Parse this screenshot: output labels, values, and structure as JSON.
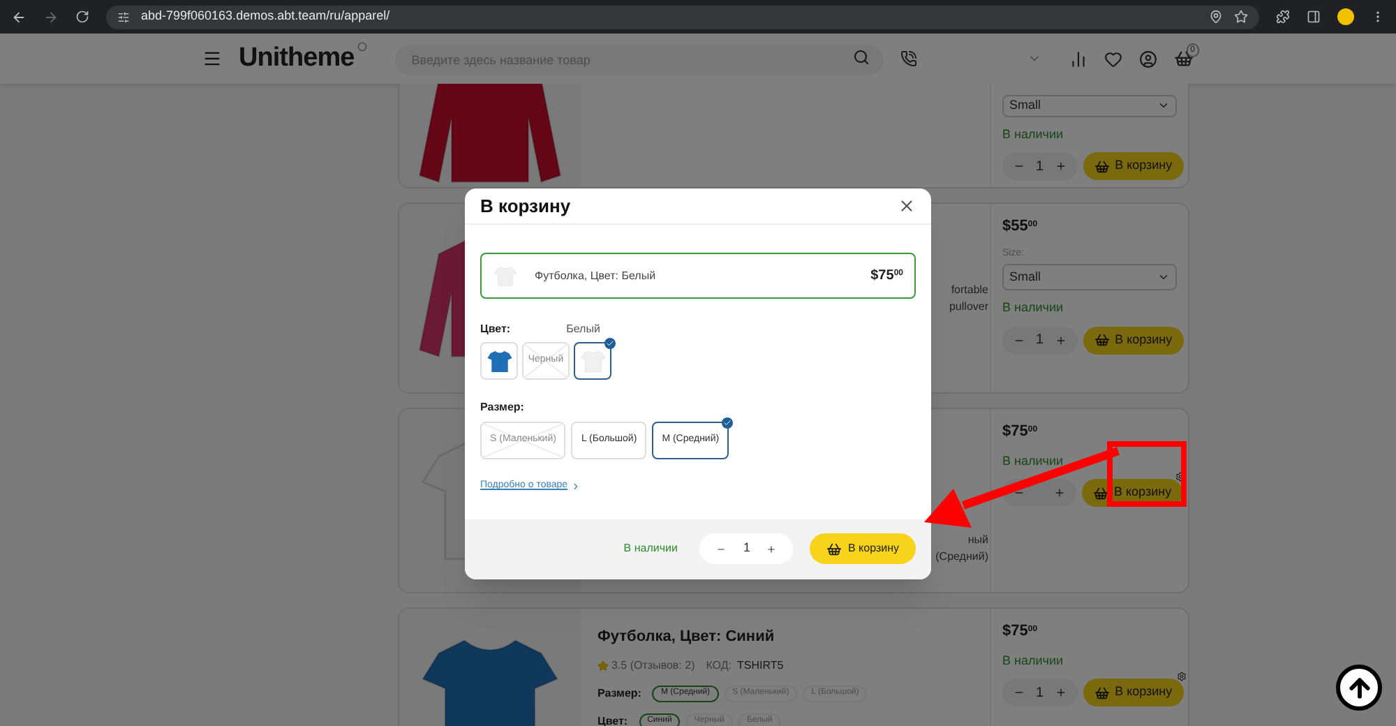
{
  "browser": {
    "url": "abd-799f060163.demos.abt.team/ru/apparel/"
  },
  "header": {
    "logo": "Unitheme",
    "search_placeholder": "Введите здесь название товар",
    "cart_count": "0"
  },
  "products": [
    {
      "kind": "partial",
      "garment": {
        "kind": "sweater",
        "color": "#640817"
      },
      "select": "Small",
      "stock": "В наличии",
      "qty": "1",
      "button": "В корзину",
      "settings_badge": false
    },
    {
      "kind": "covered",
      "garment": {
        "kind": "sweater",
        "color": "#6b1a36"
      },
      "fragments": [
        "fortable",
        "pullover"
      ],
      "price": "$55$^{00}$",
      "select_label": "Size:",
      "select": "Small",
      "stock": "В наличии",
      "qty": "1",
      "button": "В корзину",
      "settings_badge": false
    },
    {
      "kind": "covered",
      "garment": {
        "kind": "tshirt",
        "color": "#787878"
      },
      "fragments": [
        "ный",
        "(Средний)"
      ],
      "price": "$75$^{00}$",
      "stock": "В наличии",
      "button": "В корзину",
      "settings_badge": true
    },
    {
      "kind": "full",
      "garment": {
        "kind": "tshirt",
        "color": "#0f385b"
      },
      "title": "Футболка, Цвет: Синий",
      "rating": "3.5 (Отзывов: 2)",
      "code_label": "КОД:",
      "code": "TSHIRT5",
      "option_groups": [
        {
          "label": "Размер:",
          "options": [
            {
              "label": "M (Средний)",
              "selected": true
            },
            {
              "label": "S (Маленький)",
              "selected": false
            },
            {
              "label": "L (Большой)",
              "selected": false
            }
          ]
        },
        {
          "label": "Цвет:",
          "options": [
            {
              "label": "Синий",
              "selected": true
            },
            {
              "label": "Черный",
              "selected": false
            },
            {
              "label": "Белый",
              "selected": false
            }
          ]
        }
      ],
      "price": "$75$^{00}$",
      "stock": "В наличии",
      "qty": "1",
      "button": "В корзину",
      "settings_badge": true
    }
  ],
  "modal": {
    "title": "В корзину",
    "summary": {
      "name": "Футболка, Цвет: Белый",
      "price": "$75$^{00}$"
    },
    "color": {
      "label": "Цвет:",
      "value": "Белый",
      "options": [
        {
          "kind": "image",
          "color": "#1e6fb5",
          "selected": false,
          "disabled": false
        },
        {
          "kind": "text",
          "label": "Черный",
          "selected": false,
          "disabled": true
        },
        {
          "kind": "image",
          "color": "#f0f0f0",
          "selected": true,
          "disabled": false
        }
      ]
    },
    "size": {
      "label": "Размер:",
      "options": [
        {
          "label": "S (Маленький)",
          "selected": false,
          "disabled": true
        },
        {
          "label": "L (Большой)",
          "selected": false,
          "disabled": false
        },
        {
          "label": "M (Средний)",
          "selected": true,
          "disabled": false
        }
      ]
    },
    "details_link": "Подробно о товаре",
    "stock": "В наличии",
    "qty": "1",
    "button": "В корзину"
  }
}
